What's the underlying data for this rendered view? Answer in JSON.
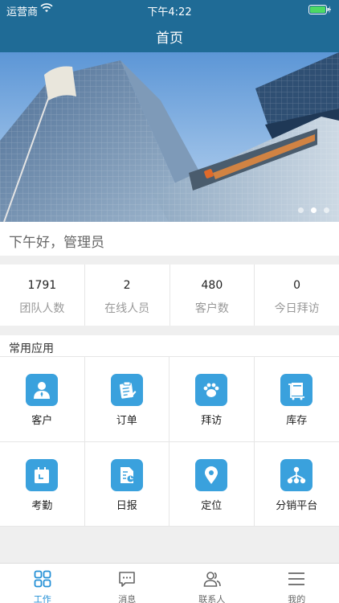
{
  "status_bar": {
    "carrier": "运营商",
    "time": "下午4:22"
  },
  "header": {
    "title": "首页"
  },
  "banner": {
    "slides": 3,
    "active_slide": 2
  },
  "greeting": "下午好，管理员",
  "stats": [
    {
      "value": "1791",
      "label": "团队人数"
    },
    {
      "value": "2",
      "label": "在线人员"
    },
    {
      "value": "480",
      "label": "客户数"
    },
    {
      "value": "0",
      "label": "今日拜访"
    }
  ],
  "apps_section": {
    "title": "常用应用"
  },
  "apps": [
    {
      "label": "客户",
      "icon": "customer-icon"
    },
    {
      "label": "订单",
      "icon": "order-icon"
    },
    {
      "label": "拜访",
      "icon": "visit-icon"
    },
    {
      "label": "库存",
      "icon": "inventory-icon"
    },
    {
      "label": "考勤",
      "icon": "attendance-icon"
    },
    {
      "label": "日报",
      "icon": "daily-report-icon"
    },
    {
      "label": "定位",
      "icon": "location-icon"
    },
    {
      "label": "分销平台",
      "icon": "distribution-icon"
    }
  ],
  "tabbar": [
    {
      "label": "工作",
      "icon": "work-icon",
      "active": true
    },
    {
      "label": "消息",
      "icon": "message-icon",
      "active": false
    },
    {
      "label": "联系人",
      "icon": "contacts-icon",
      "active": false
    },
    {
      "label": "我的",
      "icon": "menu-icon",
      "active": false
    }
  ],
  "colors": {
    "header": "#1f6b96",
    "accent": "#3aa1dd",
    "tab_active": "#2490d6"
  }
}
